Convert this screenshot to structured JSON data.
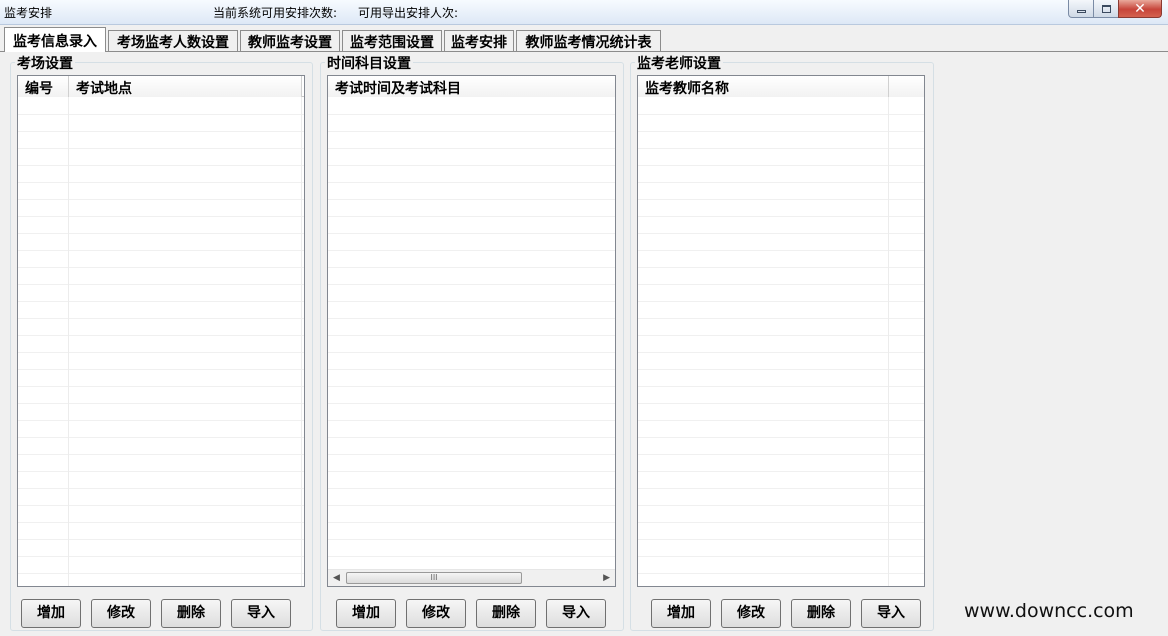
{
  "window": {
    "title": "监考安排",
    "available_count_label": "当前系统可用安排次数:",
    "export_count_label": "可用导出安排人次:",
    "minimize_icon": "minimize-icon",
    "maximize_icon": "maximize-icon",
    "close_icon": "close-icon",
    "close_glyph": "✕"
  },
  "tabs": [
    {
      "label": "监考信息录入",
      "active": true
    },
    {
      "label": "考场监考人数设置",
      "active": false
    },
    {
      "label": "教师监考设置",
      "active": false
    },
    {
      "label": "监考范围设置",
      "active": false
    },
    {
      "label": "监考安排",
      "active": false
    },
    {
      "label": "教师监考情况统计表",
      "active": false
    }
  ],
  "panels": {
    "exam_room": {
      "title": "考场设置",
      "columns": [
        "编号",
        "考试地点"
      ],
      "rows": []
    },
    "time_subject": {
      "title": "时间科目设置",
      "columns": [
        "考试时间及考试科目"
      ],
      "rows": [],
      "scrollbar_thumb": "III"
    },
    "teacher": {
      "title": "监考老师设置",
      "columns": [
        "监考教师名称",
        ""
      ],
      "rows": []
    }
  },
  "buttons": {
    "add": "增加",
    "edit": "修改",
    "delete": "删除",
    "import": "导入"
  },
  "watermark": "www.downcc.com"
}
